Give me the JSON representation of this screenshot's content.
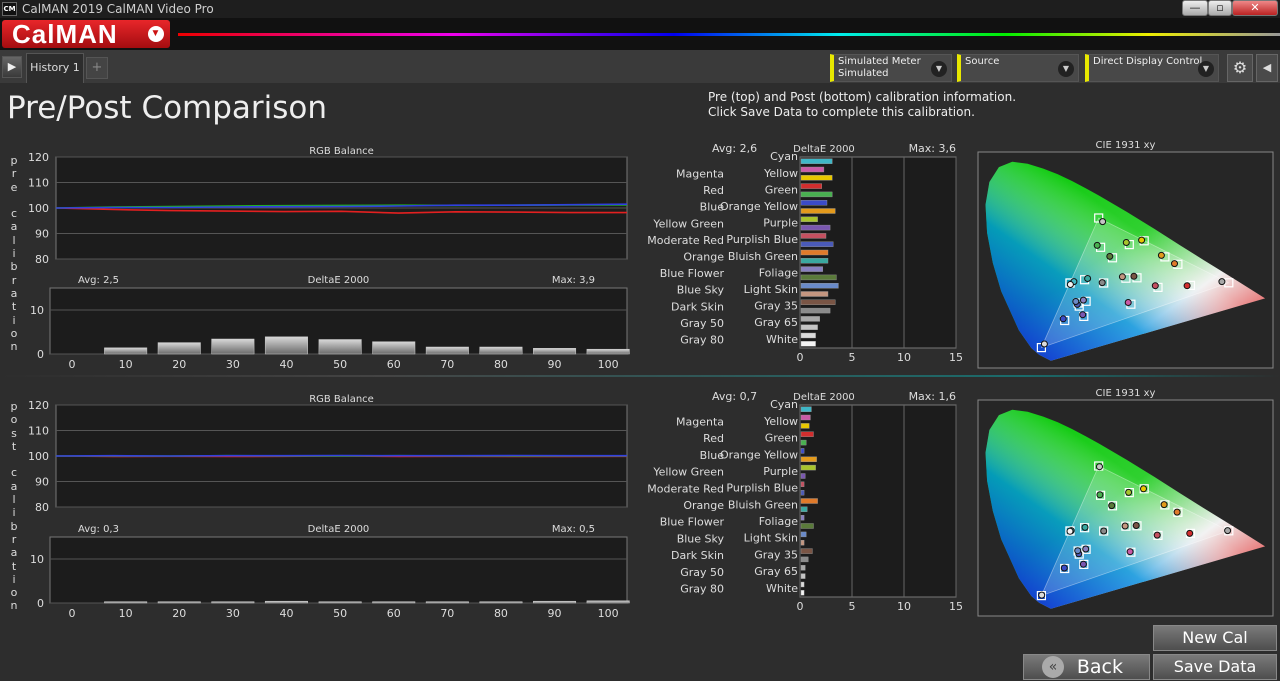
{
  "window": {
    "title": "CalMAN 2019 CalMAN Video Pro",
    "app_icon": "CM",
    "minimize": "—",
    "maximize": "▫",
    "close": "✕"
  },
  "header": {
    "logo": "CalMAN",
    "logo_menu_glyph": "▼"
  },
  "tabs": {
    "nav_glyph": "▶",
    "history_tab": "History 1",
    "add_glyph": "+"
  },
  "toolbar": {
    "meter": {
      "line1": "Simulated Meter",
      "line2": "Simulated"
    },
    "source": {
      "line1": "Source",
      "line2": ""
    },
    "display": {
      "line1": "Direct Display Control",
      "line2": ""
    },
    "settings_icon": "gear-icon",
    "collapse_glyph": "◀"
  },
  "page": {
    "title": "Pre/Post Comparison",
    "info_line1": "Pre (top) and Post (bottom) calibration information.",
    "info_line2": "Click Save Data to complete this calibration.",
    "pre_label": "pre calibration",
    "post_label": "post calibration"
  },
  "colors": {
    "red": "#e32020",
    "green": "#20b020",
    "blue": "#3040e0",
    "accent_yellow": "#e8e800"
  },
  "patch_names": [
    "Cyan",
    "Magenta",
    "Yellow",
    "Red",
    "Green",
    "Blue",
    "Orange Yellow",
    "Yellow Green",
    "Purple",
    "Moderate Red",
    "Purplish Blue",
    "Orange",
    "Bluish Green",
    "Blue Flower",
    "Foliage",
    "Blue Sky",
    "Light Skin",
    "Dark Skin",
    "Gray 35",
    "Gray 50",
    "Gray 65",
    "Gray 80",
    "White"
  ],
  "patch_colors": [
    "#3fb7c7",
    "#c95aa6",
    "#e8c800",
    "#d22e2e",
    "#49b050",
    "#3b4bc8",
    "#e39a1c",
    "#a8c42c",
    "#7a57b0",
    "#c45060",
    "#4a5ab8",
    "#e07a2a",
    "#3aa8a0",
    "#8880c0",
    "#5a7a3a",
    "#6a8ac8",
    "#c49680",
    "#7a5545",
    "#8a8a8a",
    "#a8a8a8",
    "#c4c4c4",
    "#dcdcdc",
    "#f4f4f4"
  ],
  "chart_data": [
    {
      "type": "line",
      "title": "RGB Balance",
      "panel": "pre",
      "x": [
        0,
        10,
        20,
        30,
        40,
        50,
        60,
        70,
        80,
        90,
        100
      ],
      "ylim": [
        80,
        120
      ],
      "yticks": [
        80,
        90,
        100,
        110,
        120
      ],
      "series": [
        {
          "name": "Red",
          "values": [
            100,
            99.4,
            99,
            98.8,
            98.6,
            98.7,
            98.0,
            98.5,
            98.4,
            98.2,
            98.2
          ]
        },
        {
          "name": "Green",
          "values": [
            100,
            100.4,
            100.6,
            100.8,
            100.9,
            101.0,
            101.1,
            101.0,
            101.1,
            101.2,
            101.2
          ]
        },
        {
          "name": "Blue",
          "values": [
            100,
            100.2,
            100.2,
            100.4,
            100.5,
            100.6,
            100.8,
            101.1,
            101.1,
            101.3,
            101.5
          ]
        }
      ]
    },
    {
      "type": "bar",
      "title": "DeltaE 2000",
      "panel": "pre",
      "avg": "Avg: 2,5",
      "max": "Max: 3,9",
      "categories": [
        "0",
        "10",
        "20",
        "30",
        "40",
        "50",
        "60",
        "70",
        "80",
        "90",
        "100"
      ],
      "values": [
        0,
        1.4,
        2.6,
        3.4,
        3.9,
        3.3,
        2.8,
        1.6,
        1.6,
        1.3,
        1.1
      ],
      "ylim": [
        0,
        15
      ],
      "yticks": [
        0,
        10
      ]
    },
    {
      "type": "bar",
      "title": "DeltaE 2000",
      "orientation": "horizontal",
      "panel": "pre",
      "avg": "Avg: 2,6",
      "max": "Max: 3,6",
      "categories": [
        "Cyan",
        "Magenta",
        "Yellow",
        "Red",
        "Green",
        "Blue",
        "Orange Yellow",
        "Yellow Green",
        "Purple",
        "Moderate Red",
        "Purplish Blue",
        "Orange",
        "Bluish Green",
        "Blue Flower",
        "Foliage",
        "Blue Sky",
        "Light Skin",
        "Dark Skin",
        "Gray 35",
        "Gray 50",
        "Gray 65",
        "Gray 80",
        "White"
      ],
      "values": [
        3.0,
        2.2,
        3.0,
        2.0,
        3.0,
        2.5,
        3.3,
        1.6,
        2.8,
        2.4,
        3.1,
        2.6,
        2.6,
        2.1,
        3.4,
        3.6,
        2.6,
        3.3,
        2.8,
        1.8,
        1.6,
        1.4,
        1.4
      ],
      "xlim": [
        0,
        15
      ],
      "xticks": [
        0,
        5,
        10,
        15
      ]
    },
    {
      "type": "scatter",
      "title": "CIE 1931 xy",
      "panel": "pre",
      "targets": [
        [
          0.225,
          0.329
        ],
        [
          0.384,
          0.241
        ],
        [
          0.419,
          0.505
        ],
        [
          0.54,
          0.319
        ],
        [
          0.305,
          0.478
        ],
        [
          0.211,
          0.173
        ],
        [
          0.473,
          0.438
        ],
        [
          0.38,
          0.489
        ],
        [
          0.261,
          0.19
        ],
        [
          0.455,
          0.311
        ],
        [
          0.249,
          0.233
        ],
        [
          0.507,
          0.407
        ],
        [
          0.263,
          0.343
        ],
        [
          0.267,
          0.253
        ],
        [
          0.336,
          0.434
        ],
        [
          0.246,
          0.246
        ],
        [
          0.371,
          0.349
        ],
        [
          0.4,
          0.351
        ],
        [
          0.313,
          0.329
        ],
        [
          0.64,
          0.33
        ],
        [
          0.3,
          0.6
        ],
        [
          0.15,
          0.06
        ],
        [
          0.225,
          0.329
        ]
      ],
      "measured": [
        [
          0.235,
          0.335
        ],
        [
          0.377,
          0.248
        ],
        [
          0.412,
          0.508
        ],
        [
          0.531,
          0.318
        ],
        [
          0.296,
          0.486
        ],
        [
          0.207,
          0.18
        ],
        [
          0.464,
          0.444
        ],
        [
          0.372,
          0.498
        ],
        [
          0.258,
          0.197
        ],
        [
          0.448,
          0.318
        ],
        [
          0.244,
          0.24
        ],
        [
          0.498,
          0.41
        ],
        [
          0.271,
          0.348
        ],
        [
          0.26,
          0.258
        ],
        [
          0.329,
          0.44
        ],
        [
          0.24,
          0.252
        ],
        [
          0.362,
          0.355
        ],
        [
          0.392,
          0.357
        ],
        [
          0.309,
          0.331
        ],
        [
          0.622,
          0.335
        ],
        [
          0.31,
          0.585
        ],
        [
          0.158,
          0.075
        ],
        [
          0.226,
          0.323
        ]
      ]
    },
    {
      "type": "line",
      "title": "RGB Balance",
      "panel": "post",
      "x": [
        0,
        10,
        20,
        30,
        40,
        50,
        60,
        70,
        80,
        90,
        100
      ],
      "ylim": [
        80,
        120
      ],
      "yticks": [
        80,
        90,
        100,
        110,
        120
      ],
      "series": [
        {
          "name": "Red",
          "values": [
            100,
            99.8,
            99.9,
            99.8,
            99.9,
            100,
            99.8,
            99.9,
            99.8,
            99.8,
            99.9
          ]
        },
        {
          "name": "Green",
          "values": [
            100,
            100,
            100,
            100.1,
            100,
            100,
            100.1,
            100,
            100,
            100,
            100
          ]
        },
        {
          "name": "Blue",
          "values": [
            100,
            100.1,
            100,
            100.1,
            100.1,
            100.2,
            100.1,
            100.1,
            100.2,
            100.1,
            100.1
          ]
        }
      ]
    },
    {
      "type": "bar",
      "title": "DeltaE 2000",
      "panel": "post",
      "avg": "Avg: 0,3",
      "max": "Max: 0,5",
      "categories": [
        "0",
        "10",
        "20",
        "30",
        "40",
        "50",
        "60",
        "70",
        "80",
        "90",
        "100"
      ],
      "values": [
        0,
        0.3,
        0.3,
        0.3,
        0.4,
        0.3,
        0.3,
        0.3,
        0.3,
        0.4,
        0.5
      ],
      "ylim": [
        0,
        15
      ],
      "yticks": [
        0,
        10
      ]
    },
    {
      "type": "bar",
      "title": "DeltaE 2000",
      "orientation": "horizontal",
      "panel": "post",
      "avg": "Avg: 0,7",
      "max": "Max: 1,6",
      "categories": [
        "Cyan",
        "Magenta",
        "Yellow",
        "Red",
        "Green",
        "Blue",
        "Orange Yellow",
        "Yellow Green",
        "Purple",
        "Moderate Red",
        "Purplish Blue",
        "Orange",
        "Bluish Green",
        "Blue Flower",
        "Foliage",
        "Blue Sky",
        "Light Skin",
        "Dark Skin",
        "Gray 35",
        "Gray 50",
        "Gray 65",
        "Gray 80",
        "White"
      ],
      "values": [
        1.0,
        0.9,
        0.8,
        1.2,
        0.5,
        0.3,
        1.5,
        1.4,
        0.4,
        0.3,
        0.3,
        1.6,
        0.6,
        0.3,
        1.2,
        0.5,
        0.3,
        1.1,
        0.7,
        0.4,
        0.4,
        0.3,
        0.3
      ],
      "xlim": [
        0,
        15
      ],
      "xticks": [
        0,
        5,
        10,
        15
      ]
    },
    {
      "type": "scatter",
      "title": "CIE 1931 xy",
      "panel": "post",
      "targets": [
        [
          0.225,
          0.329
        ],
        [
          0.384,
          0.241
        ],
        [
          0.419,
          0.505
        ],
        [
          0.54,
          0.319
        ],
        [
          0.305,
          0.478
        ],
        [
          0.211,
          0.173
        ],
        [
          0.473,
          0.438
        ],
        [
          0.38,
          0.489
        ],
        [
          0.261,
          0.19
        ],
        [
          0.455,
          0.311
        ],
        [
          0.249,
          0.233
        ],
        [
          0.507,
          0.407
        ],
        [
          0.263,
          0.343
        ],
        [
          0.267,
          0.253
        ],
        [
          0.336,
          0.434
        ],
        [
          0.246,
          0.246
        ],
        [
          0.371,
          0.349
        ],
        [
          0.4,
          0.351
        ],
        [
          0.313,
          0.329
        ],
        [
          0.64,
          0.33
        ],
        [
          0.3,
          0.6
        ],
        [
          0.15,
          0.06
        ],
        [
          0.225,
          0.329
        ]
      ],
      "measured": [
        [
          0.228,
          0.331
        ],
        [
          0.382,
          0.243
        ],
        [
          0.417,
          0.505
        ],
        [
          0.538,
          0.319
        ],
        [
          0.303,
          0.48
        ],
        [
          0.21,
          0.175
        ],
        [
          0.471,
          0.439
        ],
        [
          0.378,
          0.49
        ],
        [
          0.26,
          0.191
        ],
        [
          0.453,
          0.312
        ],
        [
          0.248,
          0.234
        ],
        [
          0.505,
          0.408
        ],
        [
          0.264,
          0.344
        ],
        [
          0.266,
          0.254
        ],
        [
          0.334,
          0.435
        ],
        [
          0.245,
          0.247
        ],
        [
          0.369,
          0.35
        ],
        [
          0.398,
          0.352
        ],
        [
          0.313,
          0.329
        ],
        [
          0.637,
          0.331
        ],
        [
          0.302,
          0.597
        ],
        [
          0.151,
          0.062
        ],
        [
          0.225,
          0.328
        ]
      ]
    }
  ],
  "buttons": {
    "new_cal": "New Cal",
    "back": "Back",
    "back_glyph": "«",
    "save_data": "Save Data"
  }
}
